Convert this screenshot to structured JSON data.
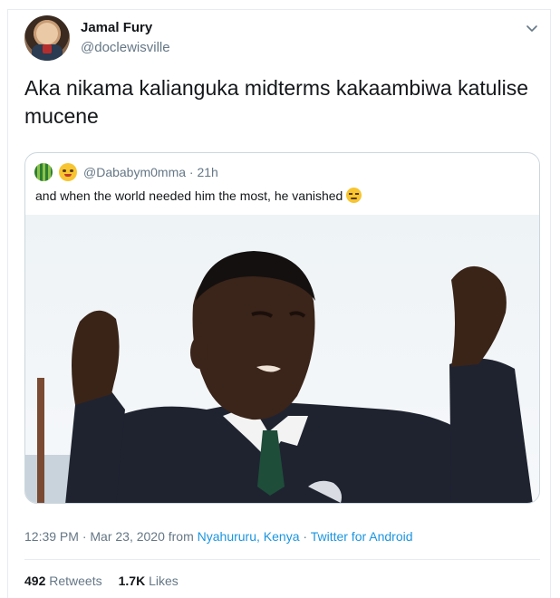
{
  "tweet": {
    "author": {
      "display_name": "Jamal Fury",
      "handle": "@doclewisville"
    },
    "text": "Aka nikama kalianguka midterms kakaambiwa katulise mucene",
    "caret_icon": "chevron-down-icon"
  },
  "quoted_tweet": {
    "handle_time": "@Dababym0mma · 21h",
    "text": "and when the world needed him the most, he vanished"
  },
  "meta": {
    "time_date": "12:39 PM · Mar 23, 2020 from ",
    "location": "Nyahururu, Kenya",
    "separator": " · ",
    "client": "Twitter for Android"
  },
  "stats": {
    "retweets_count": "492",
    "retweets_label": "Retweets",
    "likes_count": "1.7K",
    "likes_label": "Likes"
  },
  "colors": {
    "link": "#1b95e0",
    "secondary_text": "#657786",
    "border": "#e6ecf0"
  }
}
